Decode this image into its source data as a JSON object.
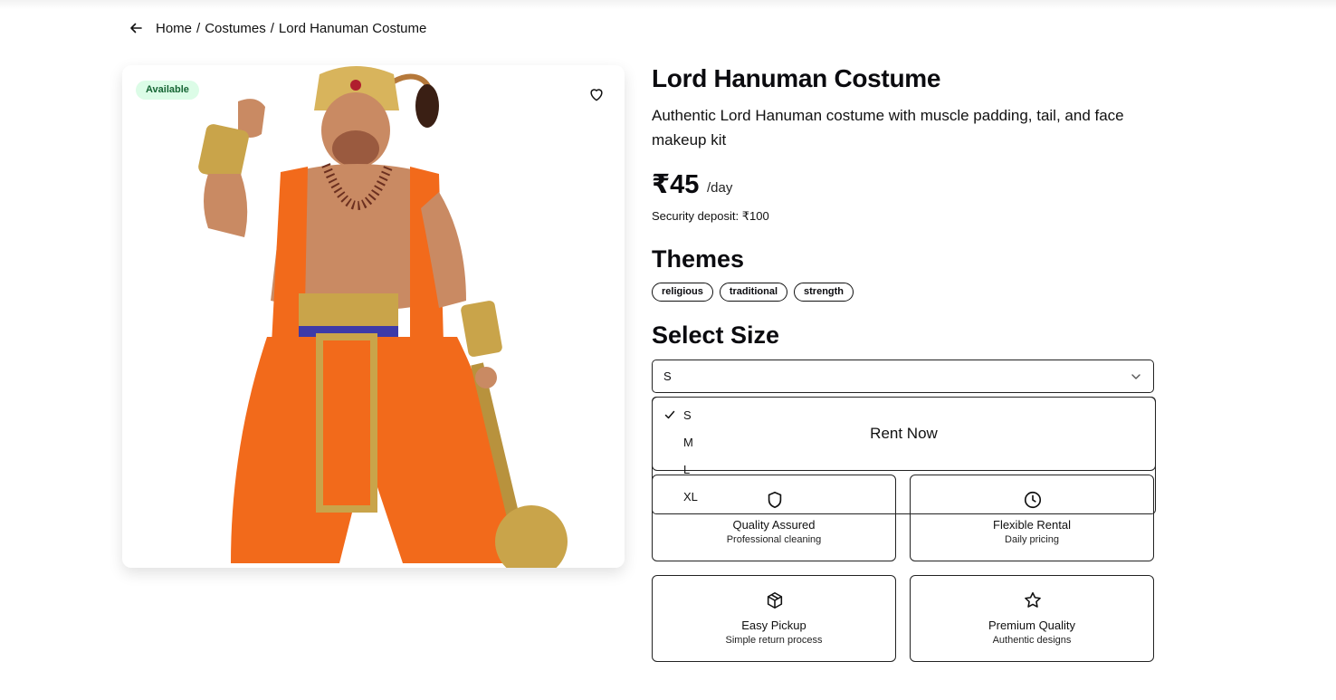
{
  "breadcrumb": {
    "items": [
      "Home",
      "Costumes",
      "Lord Hanuman Costume"
    ],
    "separator": "/"
  },
  "product": {
    "badge": "Available",
    "title": "Lord Hanuman Costume",
    "description": "Authentic Lord Hanuman costume with muscle padding, tail, and face makeup kit",
    "price": "₹45",
    "price_unit": "/day",
    "deposit": "Security deposit: ₹100",
    "favorite": false
  },
  "themes": {
    "heading": "Themes",
    "tags": [
      "religious",
      "traditional",
      "strength"
    ]
  },
  "size": {
    "heading": "Select Size",
    "selected": "S",
    "options": [
      "S",
      "M",
      "L",
      "XL"
    ],
    "dropdown_open": true
  },
  "rent_button": "Rent Now",
  "features": [
    {
      "icon": "shield-icon",
      "title": "Quality Assured",
      "subtitle": "Professional cleaning"
    },
    {
      "icon": "clock-icon",
      "title": "Flexible Rental",
      "subtitle": "Daily pricing"
    },
    {
      "icon": "package-icon",
      "title": "Easy Pickup",
      "subtitle": "Simple return process"
    },
    {
      "icon": "star-icon",
      "title": "Premium Quality",
      "subtitle": "Authentic designs"
    }
  ],
  "colors": {
    "badge_bg": "#dcfce7",
    "badge_text": "#166534",
    "border": "#222222",
    "robe": "#f26a1b",
    "gold": "#c9a44a"
  }
}
